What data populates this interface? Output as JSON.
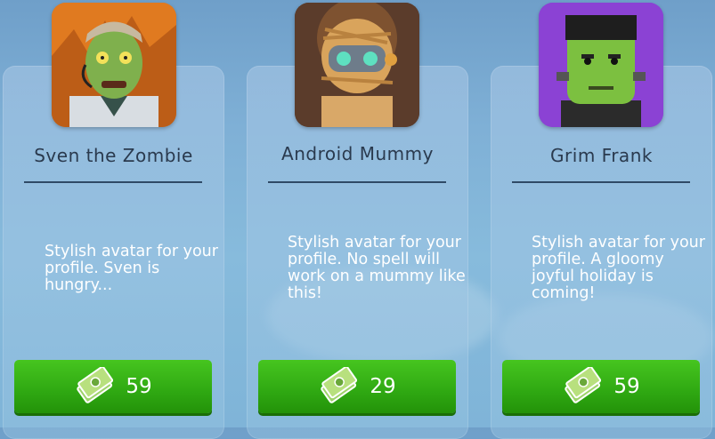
{
  "items": [
    {
      "name": "Sven the Zombie",
      "description": "Stylish avatar for your profile. Sven is hungry...",
      "price": "59",
      "avatar_icon": "zombie-avatar",
      "avatar_bg": "#e0771c"
    },
    {
      "name": "Android Mummy",
      "description": "Stylish avatar for your profile. No spell will work on a mummy like this!",
      "price": "29",
      "avatar_icon": "mummy-avatar",
      "avatar_bg": "#5a3b2a"
    },
    {
      "name": "Grim Frank",
      "description": "Stylish avatar for your profile. A gloomy joyful holiday is coming!",
      "price": "59",
      "avatar_icon": "frankenstein-avatar",
      "avatar_bg": "#8a3fd0"
    }
  ],
  "currency_icon": "cash-icon",
  "colors": {
    "button_green": "#2fa812",
    "name_text": "#2a3a4e",
    "desc_text": "#ffffff"
  }
}
